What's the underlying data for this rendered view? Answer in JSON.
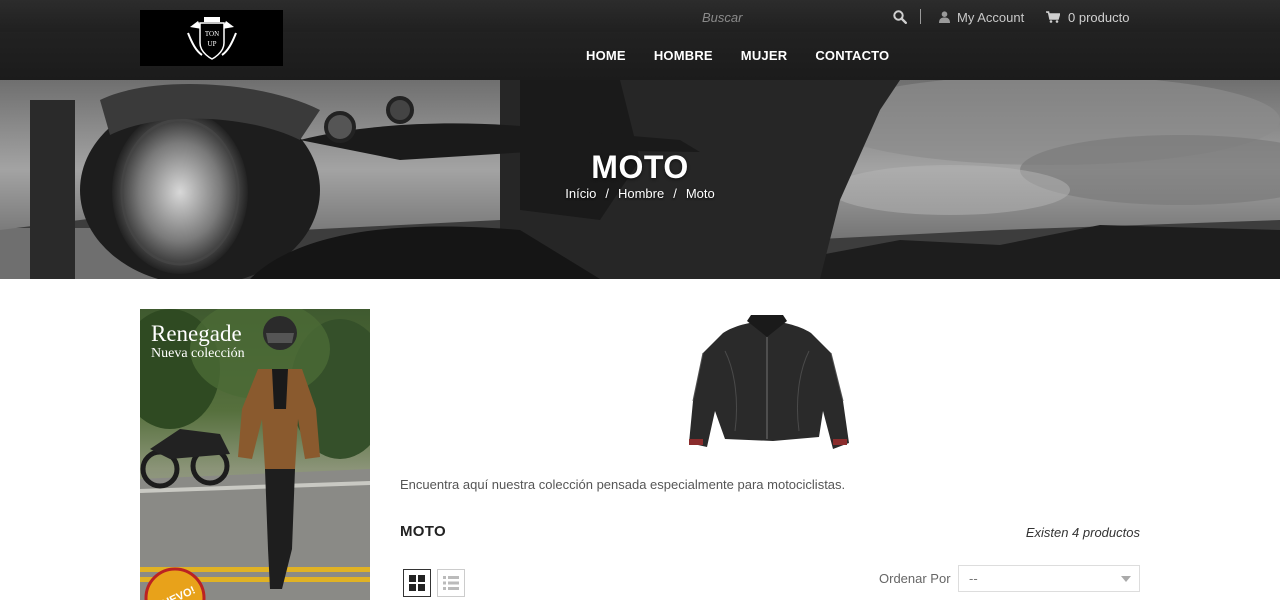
{
  "header": {
    "logo_text_top": "TON",
    "logo_text_bottom": "UP",
    "search": {
      "placeholder": "Buscar"
    },
    "account_label": "My Account",
    "cart_label": "0 producto",
    "nav": [
      {
        "label": "HOME"
      },
      {
        "label": "HOMBRE"
      },
      {
        "label": "MUJER"
      },
      {
        "label": "CONTACTO"
      }
    ],
    "icons": {
      "search": "search-icon",
      "account": "user-icon",
      "cart": "cart-icon"
    }
  },
  "hero": {
    "title": "MOTO",
    "breadcrumb": [
      {
        "label": "Início"
      },
      {
        "label": "Hombre"
      },
      {
        "label": "Moto"
      }
    ],
    "separator": "/"
  },
  "sidebar": {
    "banner": {
      "title": "Renegade",
      "subtitle": "Nueva colección",
      "badge": "NUEVO!"
    }
  },
  "category": {
    "description": "Encuentra aquí nuestra colección pensada especialmente para motociclistas.",
    "heading": "MOTO",
    "product_count": "Existen 4 productos",
    "sort_label": "Ordenar Por",
    "sort_selected": "--"
  },
  "colors": {
    "header_bg": "#1f1f1f",
    "badge": "#e8a21a"
  }
}
